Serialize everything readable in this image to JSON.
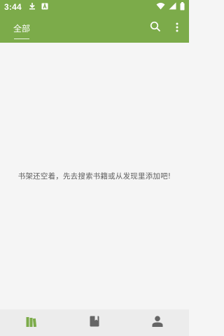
{
  "status_bar": {
    "time": "3:44",
    "icons": [
      "download-icon",
      "a-notification-icon",
      "wifi-icon",
      "signal-icon",
      "battery-icon"
    ]
  },
  "app_bar": {
    "tab_label": "全部",
    "search_icon": "search-icon",
    "more_icon": "more-vert-icon"
  },
  "content": {
    "empty_message": "书架还空着，先去搜索书籍或从发现里添加吧!"
  },
  "bottom_nav": {
    "items": [
      {
        "icon": "bookshelf-icon",
        "active": true
      },
      {
        "icon": "book-icon",
        "active": false
      },
      {
        "icon": "person-icon",
        "active": false
      }
    ]
  },
  "colors": {
    "primary": "#7cab4a",
    "background": "#f5f5f5",
    "bottom_nav": "#ececec",
    "active_icon": "#7cab4a",
    "inactive_icon": "#666666"
  }
}
